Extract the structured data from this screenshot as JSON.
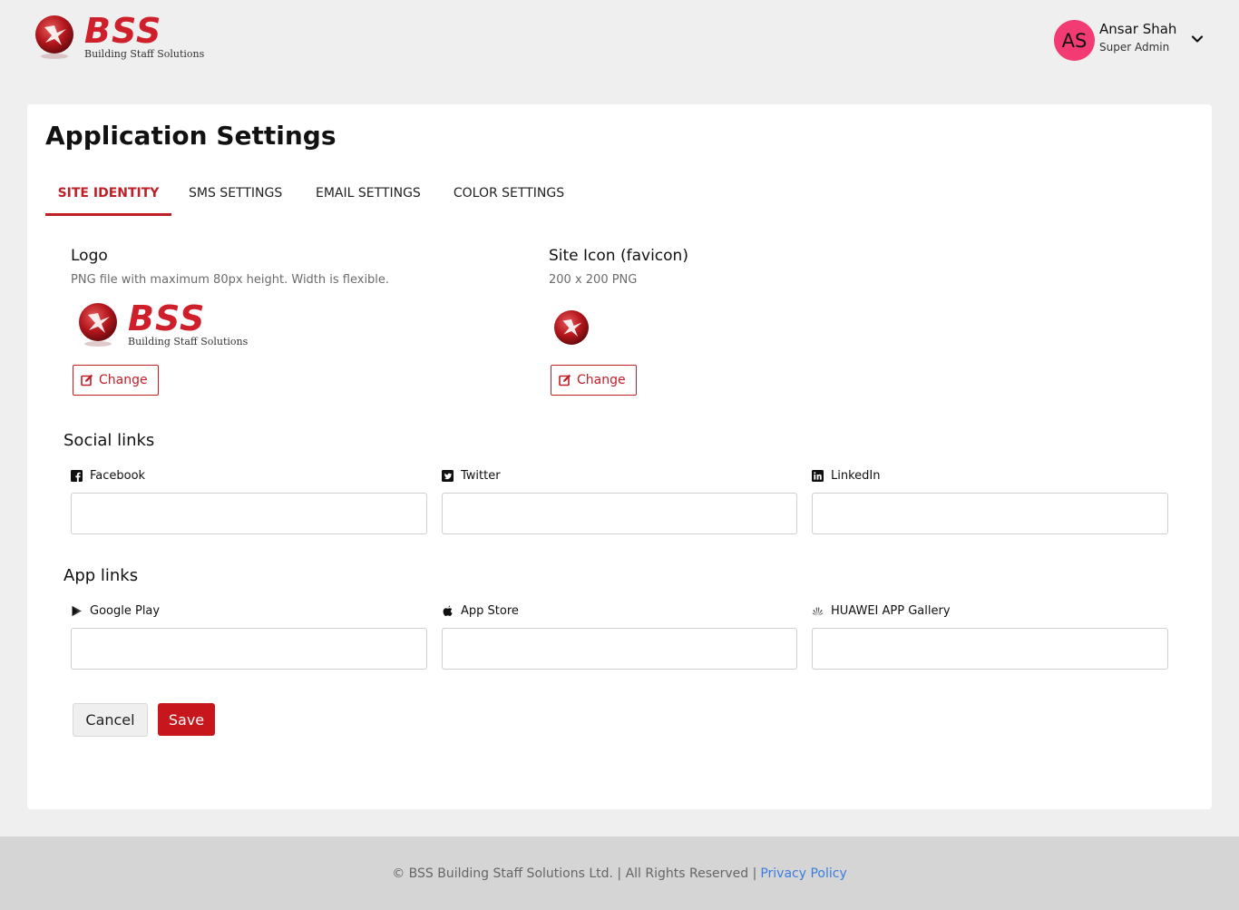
{
  "brand": {
    "name": "BSS",
    "tagline": "Building Staff Solutions",
    "color": "#cf1f2a"
  },
  "user": {
    "initials": "AS",
    "name": "Ansar Shah",
    "role": "Super Admin",
    "avatar_color": "#f33b73"
  },
  "page": {
    "title": "Application Settings"
  },
  "tabs": [
    {
      "label": "SITE IDENTITY",
      "active": true
    },
    {
      "label": "SMS SETTINGS",
      "active": false
    },
    {
      "label": "EMAIL SETTINGS",
      "active": false
    },
    {
      "label": "COLOR SETTINGS",
      "active": false
    }
  ],
  "logo": {
    "label": "Logo",
    "hint": "PNG file with maximum 80px height. Width is flexible.",
    "change_label": "Change"
  },
  "favicon": {
    "label": "Site Icon (favicon)",
    "hint": "200 x 200 PNG",
    "change_label": "Change"
  },
  "social": {
    "heading": "Social links",
    "fields": [
      {
        "label": "Facebook",
        "icon": "facebook-icon",
        "value": ""
      },
      {
        "label": "Twitter",
        "icon": "twitter-icon",
        "value": ""
      },
      {
        "label": "LinkedIn",
        "icon": "linkedin-icon",
        "value": ""
      }
    ]
  },
  "apps": {
    "heading": "App links",
    "fields": [
      {
        "label": "Google Play",
        "icon": "google-play-icon",
        "value": ""
      },
      {
        "label": "App Store",
        "icon": "apple-icon",
        "value": ""
      },
      {
        "label": "HUAWEI APP Gallery",
        "icon": "huawei-icon",
        "value": ""
      }
    ]
  },
  "actions": {
    "cancel_label": "Cancel",
    "save_label": "Save",
    "accent": "#c8161d"
  },
  "footer": {
    "text": "© BSS Building Staff Solutions Ltd. | All Rights Reserved |",
    "link_label": "Privacy Policy"
  }
}
